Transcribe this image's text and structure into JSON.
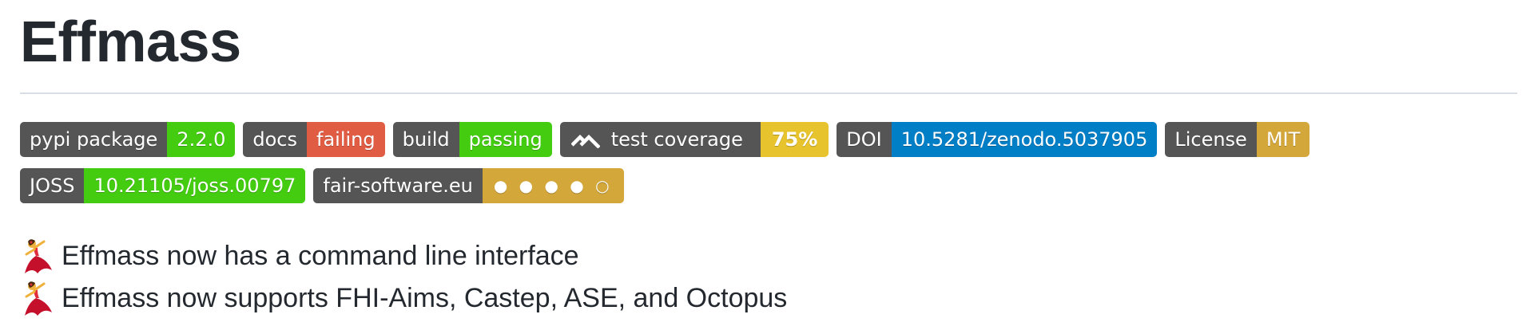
{
  "page": {
    "title": "Effmass"
  },
  "badges": {
    "row1": [
      {
        "id": "pypi",
        "label": "pypi package",
        "value": "2.2.0",
        "value_color": "#44cc11"
      },
      {
        "id": "docs",
        "label": "docs",
        "value": "failing",
        "value_color": "#e05d44"
      },
      {
        "id": "build",
        "label": "build",
        "value": "passing",
        "value_color": "#44cc11"
      },
      {
        "id": "coverage",
        "label": "test coverage",
        "value": "75%",
        "value_color": "#e7c32d",
        "icon": "codeclimate-icon"
      },
      {
        "id": "doi",
        "label": "DOI",
        "value": "10.5281/zenodo.5037905",
        "value_color": "#007ec6"
      },
      {
        "id": "license",
        "label": "License",
        "value": "MIT",
        "value_color": "#d4a73a"
      }
    ],
    "row2": [
      {
        "id": "joss",
        "label": "JOSS",
        "value": "10.21105/joss.00797",
        "value_color": "#44cc11"
      },
      {
        "id": "fair",
        "label": "fair-software.eu",
        "value": "● ● ● ● ○",
        "value_color": "#d4a73a"
      }
    ]
  },
  "announcements": [
    {
      "icon": "dancer-emoji-icon",
      "text": "Effmass now has a command line interface"
    },
    {
      "icon": "dancer-emoji-icon",
      "text": "Effmass now supports FHI-Aims, Castep, ASE, and Octopus"
    }
  ],
  "colors": {
    "badge_label_bg": "#555555",
    "text": "#24292f",
    "rule": "#d8dee4"
  }
}
